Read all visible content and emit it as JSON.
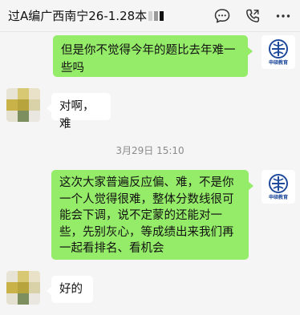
{
  "header": {
    "title": "过A编广西南宁26-1.28本",
    "actions": [
      {
        "icon": "chat-bubble-icon"
      },
      {
        "icon": "phone-icon"
      },
      {
        "icon": "more-options-icon"
      }
    ]
  },
  "colors": {
    "accent_green": "#95ec69",
    "brand_blue": "#1f4a9b"
  },
  "messages": [
    {
      "sender": "me",
      "text": "但是你不觉得今年的题比去年难一些吗"
    },
    {
      "sender": "other",
      "text": "对啊，难"
    },
    {
      "type": "timestamp",
      "text": "3月29日 15:10"
    },
    {
      "sender": "me",
      "text": "这次大家普遍反应偏、难，不是你一个人觉得很难，整体分数线很可能会下调，说不定蒙的还能对一些，先别灰心，等成绩出来我们再一起看排名、看机会"
    },
    {
      "sender": "other",
      "text": "好的"
    }
  ],
  "brand_avatar": {
    "label": "申硕教育"
  }
}
